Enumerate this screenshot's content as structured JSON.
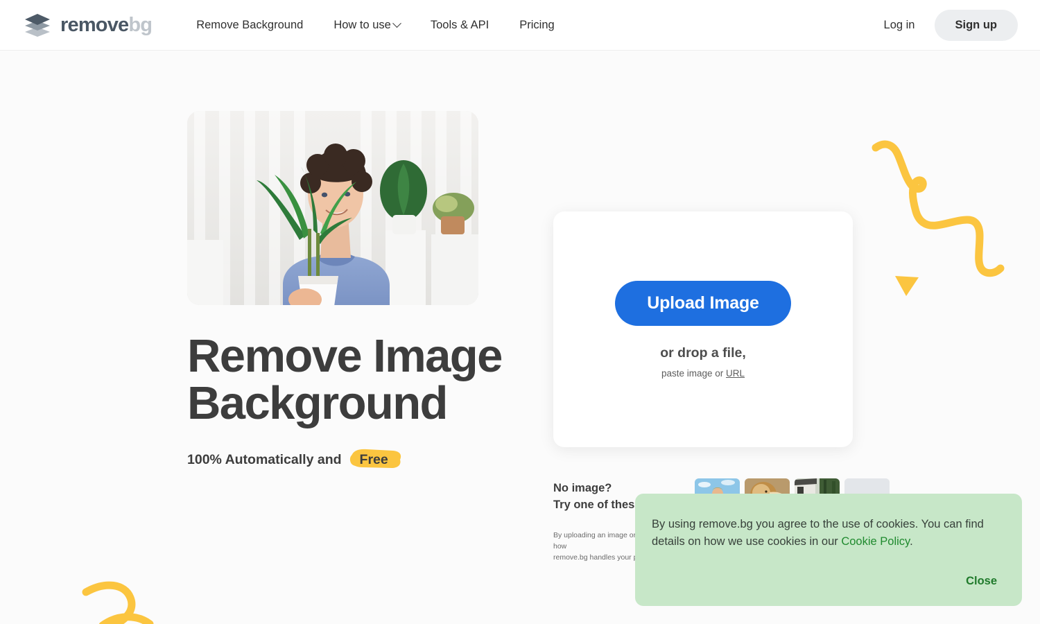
{
  "brand": {
    "name_part1": "remove",
    "name_part2": "bg",
    "logo_icon": "layers-diamond-icon"
  },
  "header": {
    "nav": [
      {
        "label": "Remove Background",
        "icon": null
      },
      {
        "label": "How to use",
        "icon": "chevron-down-icon"
      },
      {
        "label": "Tools & API",
        "icon": null
      },
      {
        "label": "Pricing",
        "icon": null
      }
    ],
    "login_label": "Log in",
    "signup_label": "Sign up"
  },
  "hero": {
    "photo_alt": "man in blue t-shirt holding a potted plant in a bright room",
    "title_line1": "Remove Image",
    "title_line2": "Background",
    "subtitle_prefix": "100% Automatically and",
    "subtitle_highlight": "Free"
  },
  "upload": {
    "button_label": "Upload Image",
    "drop_label": "or drop a file,",
    "paste_prefix": "paste image or ",
    "paste_link": "URL"
  },
  "samples": {
    "heading_line1": "No image?",
    "heading_line2": "Try one of these:",
    "thumbnails": [
      {
        "alt": "person in front of blue sky and sea"
      },
      {
        "alt": "lion portrait"
      },
      {
        "alt": "car parked by a house and trees"
      },
      {
        "alt": "grey car front view"
      }
    ]
  },
  "fineprint": {
    "line1": "By uploading an image or URL you agree to our Terms of Service. To learn more about how",
    "line2": "remove.bg handles your personal data, check our Privacy Policy."
  },
  "cookie": {
    "text_before_link": "By using remove.bg you agree to the use of cookies. You can find details on how we use cookies in our ",
    "link_label": "Cookie Policy",
    "text_after_link": ".",
    "close_label": "Close"
  },
  "colors": {
    "accent_blue": "#1e6fe0",
    "highlight_yellow": "#fbc540",
    "cookie_bg": "#c7e7c8",
    "cookie_green": "#1f8a2e",
    "signup_bg": "#eceef0",
    "text_dark": "#3d3d3d"
  }
}
